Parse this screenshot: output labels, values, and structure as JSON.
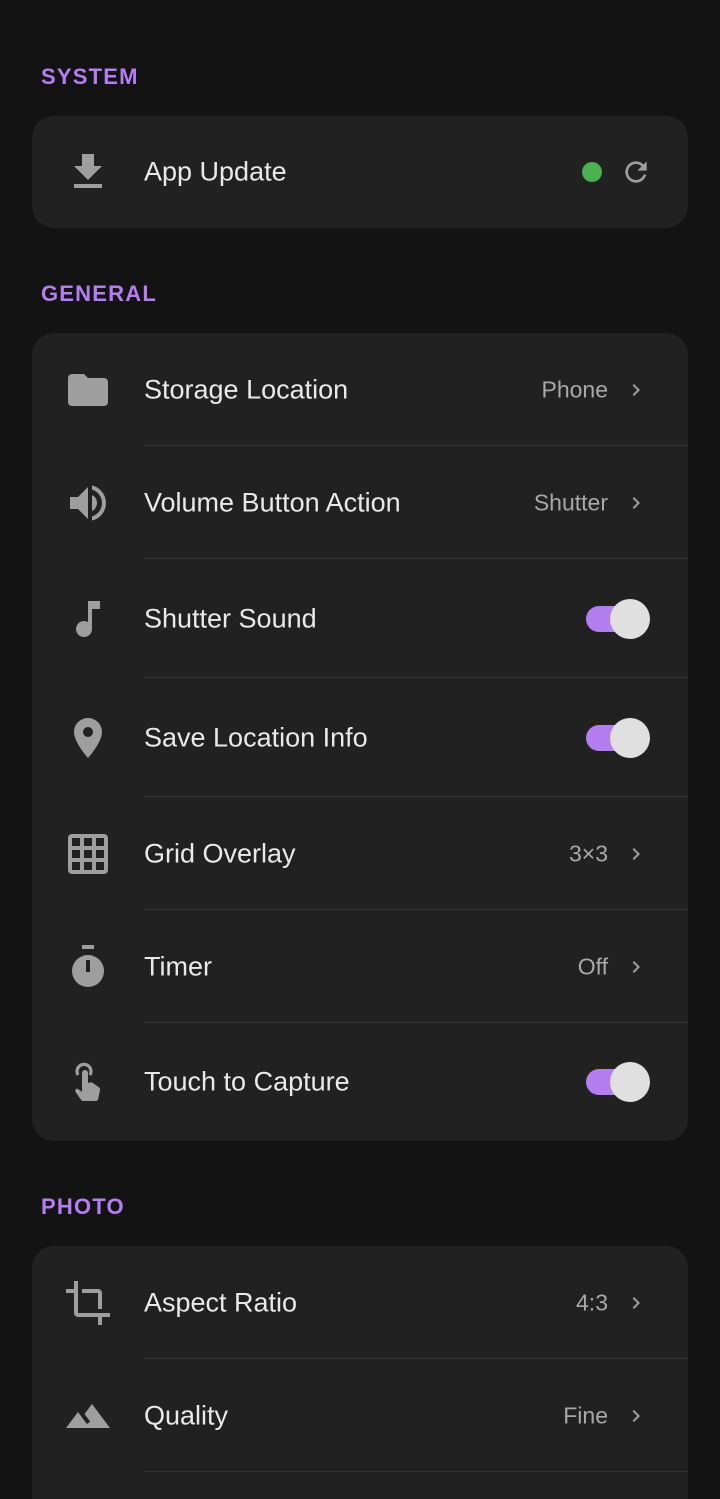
{
  "sections": [
    {
      "title": "SYSTEM",
      "items": [
        {
          "icon": "download-icon",
          "label": "App Update",
          "status_color": "#4caf50",
          "trailing_icon": "refresh-icon"
        }
      ]
    },
    {
      "title": "GENERAL",
      "items": [
        {
          "icon": "folder-icon",
          "label": "Storage Location",
          "value": "Phone"
        },
        {
          "icon": "volume-icon",
          "label": "Volume Button Action",
          "value": "Shutter"
        },
        {
          "icon": "music-note-icon",
          "label": "Shutter Sound",
          "toggle": true
        },
        {
          "icon": "location-pin-icon",
          "label": "Save Location Info",
          "toggle": true
        },
        {
          "icon": "grid-icon",
          "label": "Grid Overlay",
          "value": "3×3"
        },
        {
          "icon": "timer-icon",
          "label": "Timer",
          "value": "Off"
        },
        {
          "icon": "touch-icon",
          "label": "Touch to Capture",
          "toggle": true
        }
      ]
    },
    {
      "title": "PHOTO",
      "items": [
        {
          "icon": "crop-icon",
          "label": "Aspect Ratio",
          "value": "4:3"
        },
        {
          "icon": "landscape-icon",
          "label": "Quality",
          "value": "Fine"
        }
      ]
    }
  ],
  "colors": {
    "background": "#131313",
    "card": "#212121",
    "accent": "#b57ef0",
    "toggle_knob": "#e0e0e0"
  }
}
